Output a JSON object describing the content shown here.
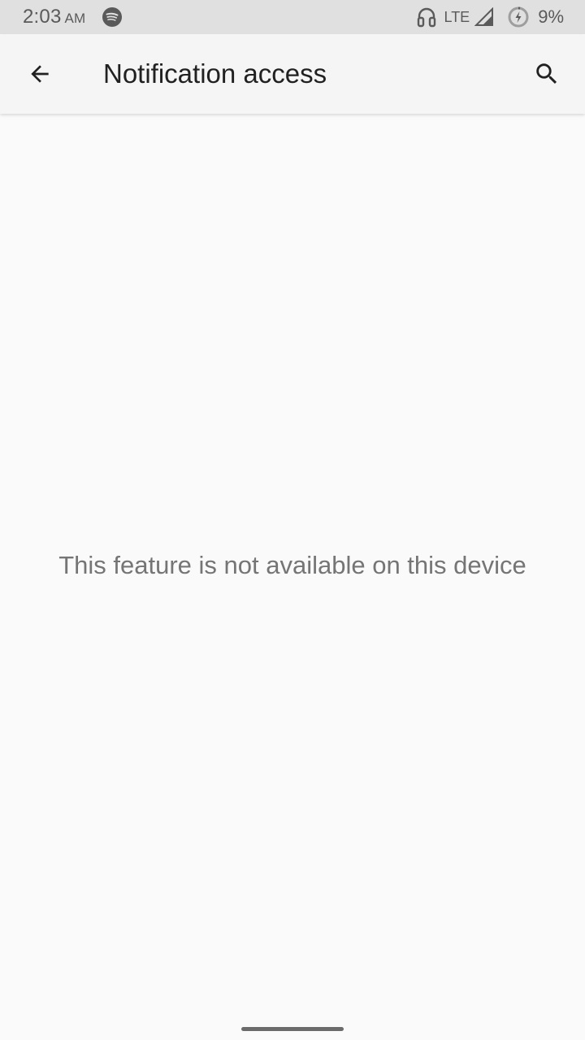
{
  "status_bar": {
    "time": "2:03",
    "ampm": "AM",
    "network": "LTE",
    "battery_percent": "9%",
    "icons": [
      "spotify-icon",
      "headset-icon",
      "signal-icon",
      "battery-saver-icon"
    ]
  },
  "app_bar": {
    "title": "Notification access",
    "back_icon": "arrow-back-icon",
    "search_icon": "search-icon"
  },
  "main": {
    "message": "This feature is not available on this device"
  },
  "colors": {
    "status_bar_bg": "#e0e0e0",
    "app_bar_bg": "#f5f5f5",
    "page_bg": "#fafafa",
    "title_text": "#212121",
    "message_text": "#757575"
  }
}
